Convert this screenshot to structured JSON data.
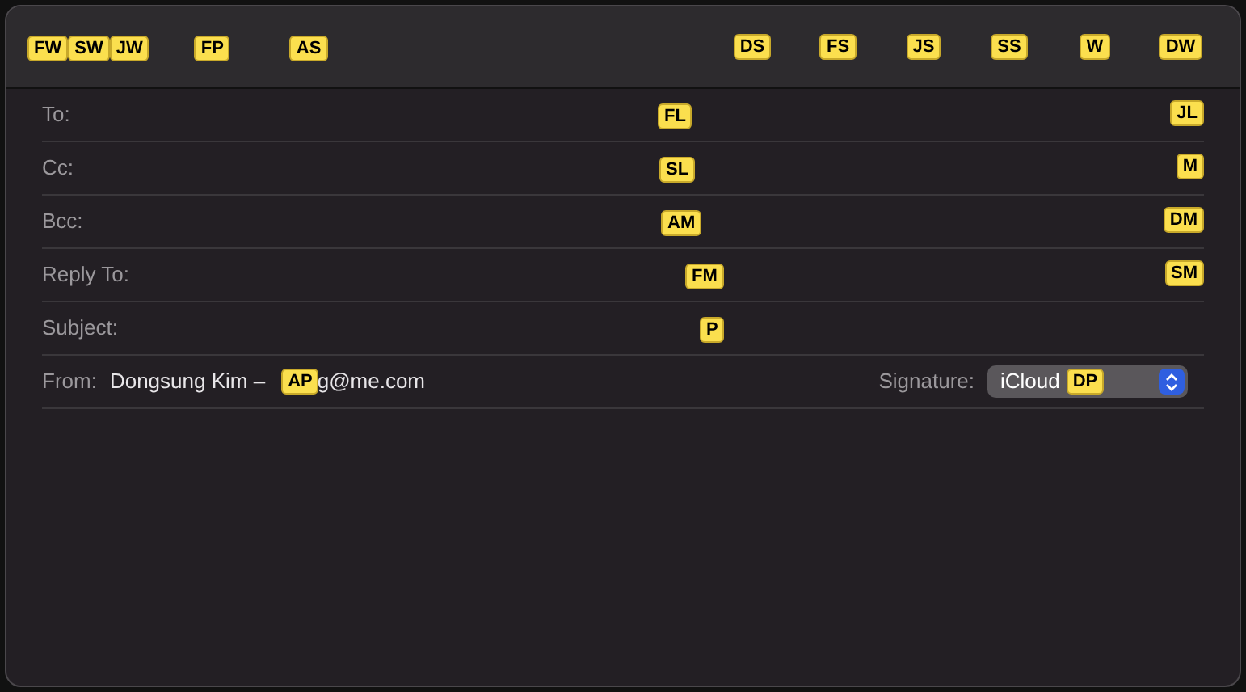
{
  "toolbar": {
    "hints": [
      "FW",
      "SW",
      "JW",
      "FP",
      "AS",
      "DS",
      "FS",
      "JS",
      "SS",
      "W",
      "DW"
    ]
  },
  "fields": [
    {
      "label": "To:",
      "hints": [
        "FL",
        "JL"
      ]
    },
    {
      "label": "Cc:",
      "hints": [
        "SL",
        "M"
      ]
    },
    {
      "label": "Bcc:",
      "hints": [
        "AM",
        "DM"
      ]
    },
    {
      "label": "Reply To:",
      "hints": [
        "FM",
        "SM"
      ]
    },
    {
      "label": "Subject:",
      "hints": [
        "P"
      ]
    }
  ],
  "from": {
    "label": "From:",
    "value_start": "Dongsung Kim –",
    "hint": "AP",
    "value_end": "g@me.com"
  },
  "signature": {
    "label": "Signature:",
    "value": "iCloud",
    "hint": "DP"
  }
}
